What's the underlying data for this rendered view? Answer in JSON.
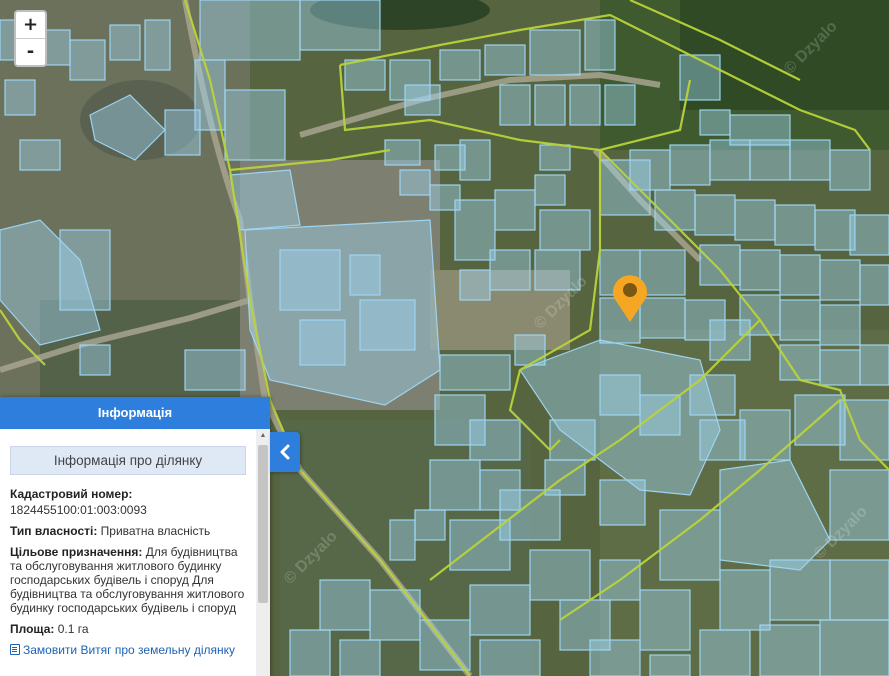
{
  "map": {
    "zoom_in": "+",
    "zoom_out": "-",
    "marker_icon": "location-pin-icon",
    "marker_color": "#f5a623",
    "parcel_color": "#9fd7f5",
    "boundary_color": "#b9d33a",
    "watermark_text": "© Dzyalo"
  },
  "panel": {
    "header": "Інформація",
    "subtitle": "Інформація про ділянку",
    "cadastral_label": "Кадастровий номер:",
    "cadastral_value": "1824455100:01:003:0093",
    "ownership_label": "Тип власності:",
    "ownership_value": "Приватна власність",
    "purpose_label": "Цільове призначення:",
    "purpose_value": "Для будівництва та обслуговування житлового будинку господарських будівель і споруд Для будівництва та обслуговування житлового будинку господарських будівель і споруд",
    "area_label": "Площа:",
    "area_value": "0.1 га",
    "order_link": "Замовити Витяг про земельну ділянку",
    "accent_color": "#2e7fdd",
    "collapse_icon": "chevron-left-icon"
  }
}
